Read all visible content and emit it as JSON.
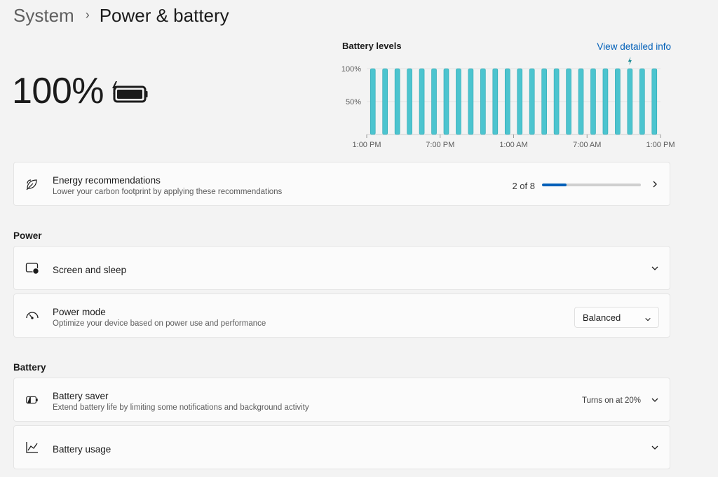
{
  "breadcrumb": {
    "parent": "System",
    "separator": "›",
    "current": "Power & battery"
  },
  "battery": {
    "percent_text": "100%",
    "icon": "battery-charging-icon"
  },
  "battery_levels": {
    "title": "Battery levels",
    "link": "View detailed info",
    "charging_indicator_icon": "lightning-icon"
  },
  "chart_data": {
    "type": "bar",
    "title": "Battery levels",
    "y_tick_labels": [
      "100%",
      "50%"
    ],
    "x_tick_labels": [
      "1:00 PM",
      "7:00 PM",
      "1:00 AM",
      "7:00 AM",
      "1:00 PM"
    ],
    "ylim": [
      0,
      100
    ],
    "values": [
      100,
      100,
      100,
      100,
      100,
      100,
      100,
      100,
      100,
      100,
      100,
      100,
      100,
      100,
      100,
      100,
      100,
      100,
      100,
      100,
      100,
      100,
      100,
      100
    ],
    "charging_bar_index": 21,
    "grid": true,
    "color": "#4cc4cf"
  },
  "energy": {
    "title": "Energy recommendations",
    "subtitle": "Lower your carbon footprint by applying these recommendations",
    "count_text": "2 of 8",
    "progress": 0.25,
    "icon": "leaf-icon",
    "chevron": "chevron-right-icon"
  },
  "power_section": {
    "label": "Power",
    "screen_sleep": {
      "title": "Screen and sleep",
      "icon": "screen-sleep-icon",
      "chevron": "chevron-down-icon"
    },
    "power_mode": {
      "title": "Power mode",
      "subtitle": "Optimize your device based on power use and performance",
      "selected": "Balanced",
      "icon": "speedometer-icon"
    }
  },
  "battery_section": {
    "label": "Battery",
    "saver": {
      "title": "Battery saver",
      "subtitle": "Extend battery life by limiting some notifications and background activity",
      "status": "Turns on at 20%",
      "icon": "battery-saver-icon",
      "chevron": "chevron-down-icon"
    },
    "usage": {
      "title": "Battery usage",
      "icon": "chart-line-icon",
      "chevron": "chevron-down-icon"
    }
  },
  "colors": {
    "accent": "#005fb8",
    "bar": "#4cc4cf",
    "background": "#f3f3f3",
    "card": "#fbfbfb"
  }
}
